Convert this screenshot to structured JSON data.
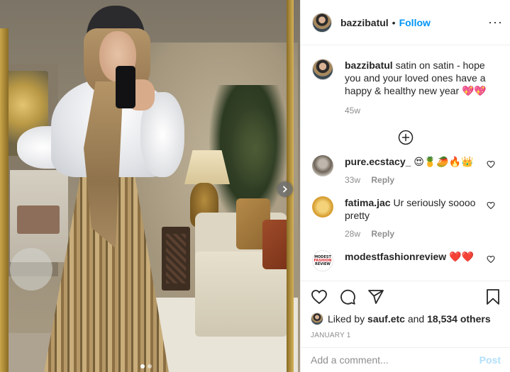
{
  "post": {
    "username": "bazzibatul",
    "bullet": "•",
    "follow_label": "Follow",
    "more_label": "···"
  },
  "caption": {
    "username": "bazzibatul",
    "text": "satin on satin - hope you and your loved ones have a happy & healthy new year 💖💖",
    "time": "45w"
  },
  "comments": [
    {
      "username": "pure.ecstacy_",
      "text": "😍🍍🥭🔥👑",
      "time": "33w",
      "reply_label": "Reply"
    },
    {
      "username": "fatima.jac",
      "text": "Ur seriously soooo pretty",
      "time": "28w",
      "reply_label": "Reply"
    },
    {
      "username": "modestfashionreview",
      "text": "❤️❤️",
      "time": "",
      "reply_label": ""
    }
  ],
  "modest_logo": {
    "line1": "MODEST",
    "line2": "FASHION",
    "line3": "REVIEW"
  },
  "likes": {
    "prefix": "Liked by",
    "first_user": "sauf.etc",
    "conjunction": "and",
    "others": "18,534 others"
  },
  "date": "JANUARY 1",
  "comment_input": {
    "placeholder": "Add a comment..."
  },
  "post_button_label": "Post",
  "carousel": {
    "slides": 2,
    "active": 1
  },
  "colors": {
    "link": "#0095f6",
    "muted": "#8e8e8e",
    "post_disabled": "#b2dffc"
  }
}
